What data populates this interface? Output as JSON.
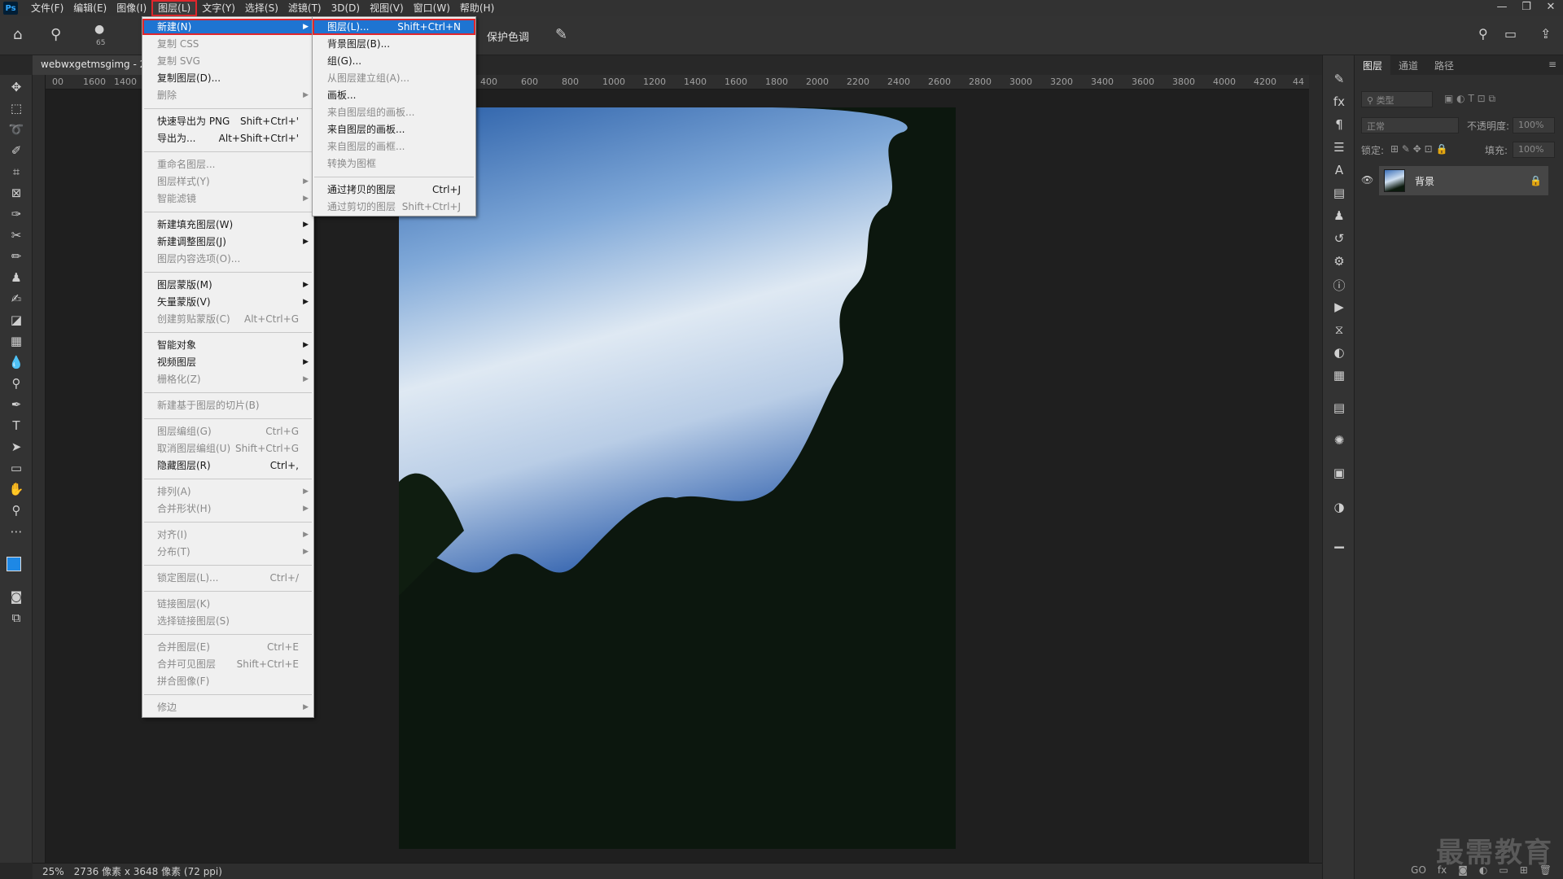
{
  "menubar": {
    "logo": "Ps",
    "items": [
      "文件(F)",
      "编辑(E)",
      "图像(I)",
      "图层(L)",
      "文字(Y)",
      "选择(S)",
      "滤镜(T)",
      "3D(D)",
      "视图(V)",
      "窗口(W)",
      "帮助(H)"
    ],
    "active_index": 3
  },
  "window_controls": {
    "minimize": "—",
    "restore": "❐",
    "close": "✕"
  },
  "options": {
    "brush_size": "65",
    "protect_tone": "保护色调"
  },
  "document": {
    "tab_title": "webwxgetmsgimg - 2"
  },
  "ruler": {
    "h_ticks": [
      "00",
      "1600",
      "1400",
      "400",
      "600",
      "800",
      "1000",
      "1200",
      "1400",
      "1600",
      "1800",
      "2000",
      "2200",
      "2400",
      "2600",
      "2800",
      "3000",
      "3200",
      "3400",
      "3600",
      "3800",
      "4000",
      "4200",
      "44"
    ]
  },
  "status": {
    "zoom": "25%",
    "info": "2736 像素 x 3648 像素 (72 ppi)"
  },
  "layer_menu": {
    "items": [
      {
        "label": "新建(N)",
        "sc": "",
        "sub": true,
        "state": "hl"
      },
      {
        "label": "复制 CSS",
        "sc": "",
        "state": "dis"
      },
      {
        "label": "复制 SVG",
        "sc": "",
        "state": "dis"
      },
      {
        "label": "复制图层(D)...",
        "sc": ""
      },
      {
        "label": "删除",
        "sc": "",
        "sub": true,
        "state": "dis"
      },
      {
        "sep": true
      },
      {
        "label": "快速导出为 PNG",
        "sc": "Shift+Ctrl+'"
      },
      {
        "label": "导出为...",
        "sc": "Alt+Shift+Ctrl+'"
      },
      {
        "sep": true
      },
      {
        "label": "重命名图层...",
        "sc": "",
        "state": "dis"
      },
      {
        "label": "图层样式(Y)",
        "sc": "",
        "sub": true,
        "state": "dis"
      },
      {
        "label": "智能滤镜",
        "sc": "",
        "sub": true,
        "state": "dis"
      },
      {
        "sep": true
      },
      {
        "label": "新建填充图层(W)",
        "sc": "",
        "sub": true
      },
      {
        "label": "新建调整图层(J)",
        "sc": "",
        "sub": true
      },
      {
        "label": "图层内容选项(O)...",
        "sc": "",
        "state": "dis"
      },
      {
        "sep": true
      },
      {
        "label": "图层蒙版(M)",
        "sc": "",
        "sub": true
      },
      {
        "label": "矢量蒙版(V)",
        "sc": "",
        "sub": true
      },
      {
        "label": "创建剪贴蒙版(C)",
        "sc": "Alt+Ctrl+G",
        "state": "dis"
      },
      {
        "sep": true
      },
      {
        "label": "智能对象",
        "sc": "",
        "sub": true
      },
      {
        "label": "视频图层",
        "sc": "",
        "sub": true
      },
      {
        "label": "栅格化(Z)",
        "sc": "",
        "sub": true,
        "state": "dis"
      },
      {
        "sep": true
      },
      {
        "label": "新建基于图层的切片(B)",
        "sc": "",
        "state": "dis"
      },
      {
        "sep": true
      },
      {
        "label": "图层编组(G)",
        "sc": "Ctrl+G",
        "state": "dis"
      },
      {
        "label": "取消图层编组(U)",
        "sc": "Shift+Ctrl+G",
        "state": "dis"
      },
      {
        "label": "隐藏图层(R)",
        "sc": "Ctrl+,"
      },
      {
        "sep": true
      },
      {
        "label": "排列(A)",
        "sc": "",
        "sub": true,
        "state": "dis"
      },
      {
        "label": "合并形状(H)",
        "sc": "",
        "sub": true,
        "state": "dis"
      },
      {
        "sep": true
      },
      {
        "label": "对齐(I)",
        "sc": "",
        "sub": true,
        "state": "dis"
      },
      {
        "label": "分布(T)",
        "sc": "",
        "sub": true,
        "state": "dis"
      },
      {
        "sep": true
      },
      {
        "label": "锁定图层(L)...",
        "sc": "Ctrl+/",
        "state": "dis"
      },
      {
        "sep": true
      },
      {
        "label": "链接图层(K)",
        "sc": "",
        "state": "dis"
      },
      {
        "label": "选择链接图层(S)",
        "sc": "",
        "state": "dis"
      },
      {
        "sep": true
      },
      {
        "label": "合并图层(E)",
        "sc": "Ctrl+E",
        "state": "dis"
      },
      {
        "label": "合并可见图层",
        "sc": "Shift+Ctrl+E",
        "state": "dis"
      },
      {
        "label": "拼合图像(F)",
        "sc": "",
        "state": "dis"
      },
      {
        "sep": true
      },
      {
        "label": "修边",
        "sc": "",
        "sub": true,
        "state": "dis"
      }
    ]
  },
  "new_submenu": {
    "items": [
      {
        "label": "图层(L)...",
        "sc": "Shift+Ctrl+N",
        "state": "hl"
      },
      {
        "label": "背景图层(B)...",
        "sc": ""
      },
      {
        "label": "组(G)...",
        "sc": ""
      },
      {
        "label": "从图层建立组(A)...",
        "sc": "",
        "state": "dis"
      },
      {
        "label": "画板...",
        "sc": ""
      },
      {
        "label": "来自图层组的画板...",
        "sc": "",
        "state": "dis"
      },
      {
        "label": "来自图层的画板...",
        "sc": ""
      },
      {
        "label": "来自图层的画框...",
        "sc": "",
        "state": "dis"
      },
      {
        "label": "转换为图框",
        "sc": "",
        "state": "dis"
      },
      {
        "sep": true
      },
      {
        "label": "通过拷贝的图层",
        "sc": "Ctrl+J"
      },
      {
        "label": "通过剪切的图层",
        "sc": "Shift+Ctrl+J",
        "state": "dis"
      }
    ]
  },
  "layers_panel": {
    "tabs": [
      "图层",
      "通道",
      "路径"
    ],
    "filter_placeholder": "类型",
    "blend_mode": "正常",
    "opacity_label": "不透明度:",
    "opacity_value": "100%",
    "lock_label": "锁定:",
    "fill_label": "填充:",
    "fill_value": "100%",
    "layer_name": "背景",
    "bottom_icons": [
      "GO",
      "fx"
    ]
  },
  "watermark": "最需教育"
}
